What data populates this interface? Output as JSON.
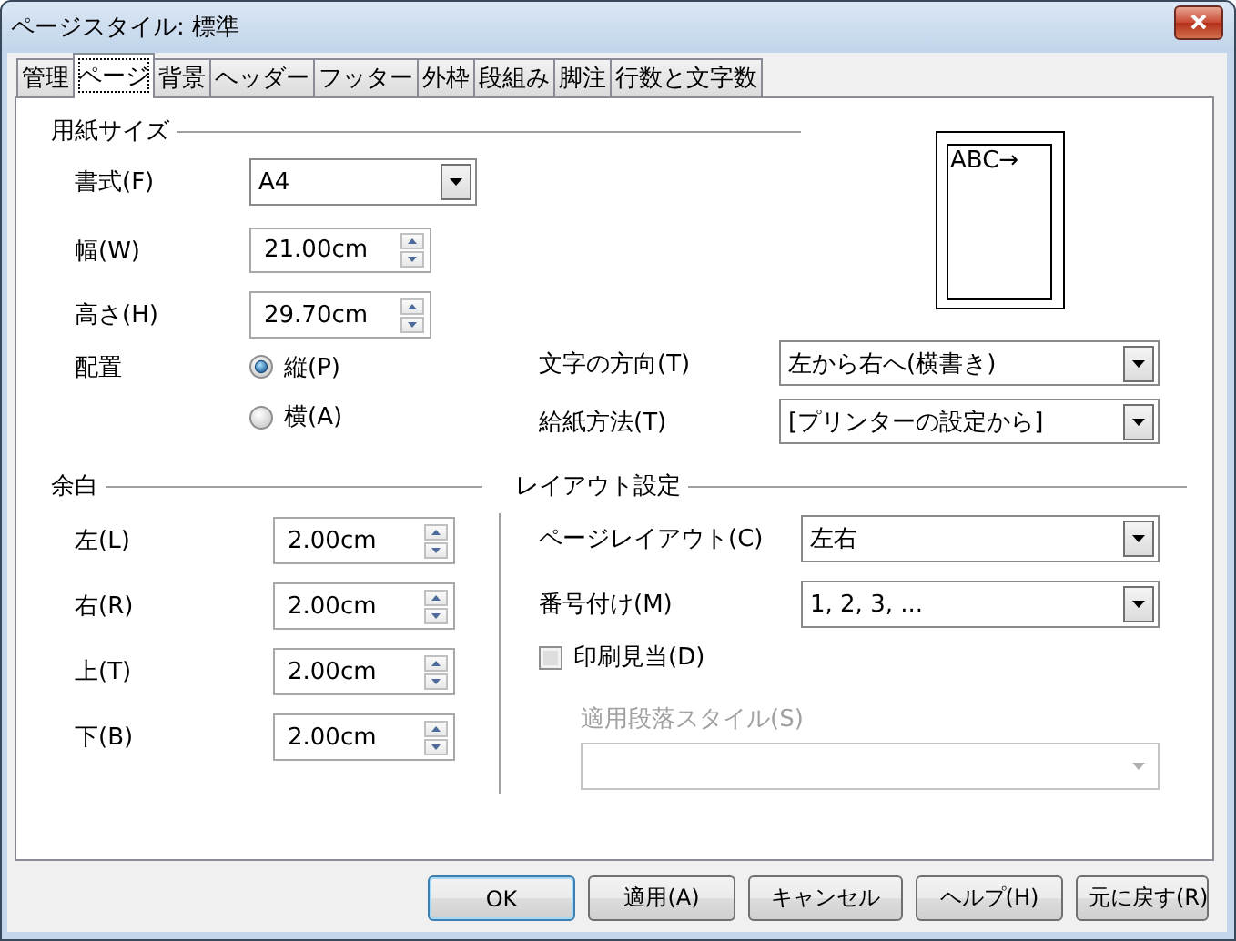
{
  "window": {
    "title": "ページスタイル: 標準"
  },
  "tabs": [
    {
      "label": "管理",
      "selected": false
    },
    {
      "label": "ページ",
      "selected": true
    },
    {
      "label": "背景",
      "selected": false
    },
    {
      "label": "ヘッダー",
      "selected": false
    },
    {
      "label": "フッター",
      "selected": false
    },
    {
      "label": "外枠",
      "selected": false
    },
    {
      "label": "段組み",
      "selected": false
    },
    {
      "label": "脚注",
      "selected": false
    },
    {
      "label": "行数と文字数",
      "selected": false
    }
  ],
  "paper_size": {
    "heading": "用紙サイズ",
    "format": {
      "label": "書式(F)",
      "value": "A4"
    },
    "width": {
      "label": "幅(W)",
      "value": "21.00cm"
    },
    "height": {
      "label": "高さ(H)",
      "value": "29.70cm"
    },
    "orientation": {
      "label": "配置",
      "options": [
        {
          "label": "縦(P)",
          "selected": true
        },
        {
          "label": "横(A)",
          "selected": false
        }
      ]
    },
    "text_direction": {
      "label": "文字の方向(T)",
      "value": "左から右へ(横書き)"
    },
    "paper_tray": {
      "label": "給紙方法(T)",
      "value": "[プリンターの設定から]"
    },
    "preview": {
      "text": "ABC→"
    }
  },
  "margins": {
    "heading": "余白",
    "fields": [
      {
        "label": "左(L)",
        "value": "2.00cm"
      },
      {
        "label": "右(R)",
        "value": "2.00cm"
      },
      {
        "label": "上(T)",
        "value": "2.00cm"
      },
      {
        "label": "下(B)",
        "value": "2.00cm"
      }
    ]
  },
  "layout_settings": {
    "heading": "レイアウト設定",
    "page_layout": {
      "label": "ページレイアウト(C)",
      "value": "左右"
    },
    "numbering": {
      "label": "番号付け(M)",
      "value": "1, 2, 3, ..."
    },
    "register_true": {
      "label": "印刷見当(D)",
      "checked": false
    },
    "reference_style": {
      "label": "適用段落スタイル(S)",
      "disabled": true
    }
  },
  "buttons": [
    {
      "label": "OK",
      "default": true
    },
    {
      "label": "適用(A)",
      "default": false
    },
    {
      "label": "キャンセル",
      "default": false
    },
    {
      "label": "ヘルプ(H)",
      "default": false
    },
    {
      "label": "元に戻す(R)",
      "default": false
    }
  ]
}
